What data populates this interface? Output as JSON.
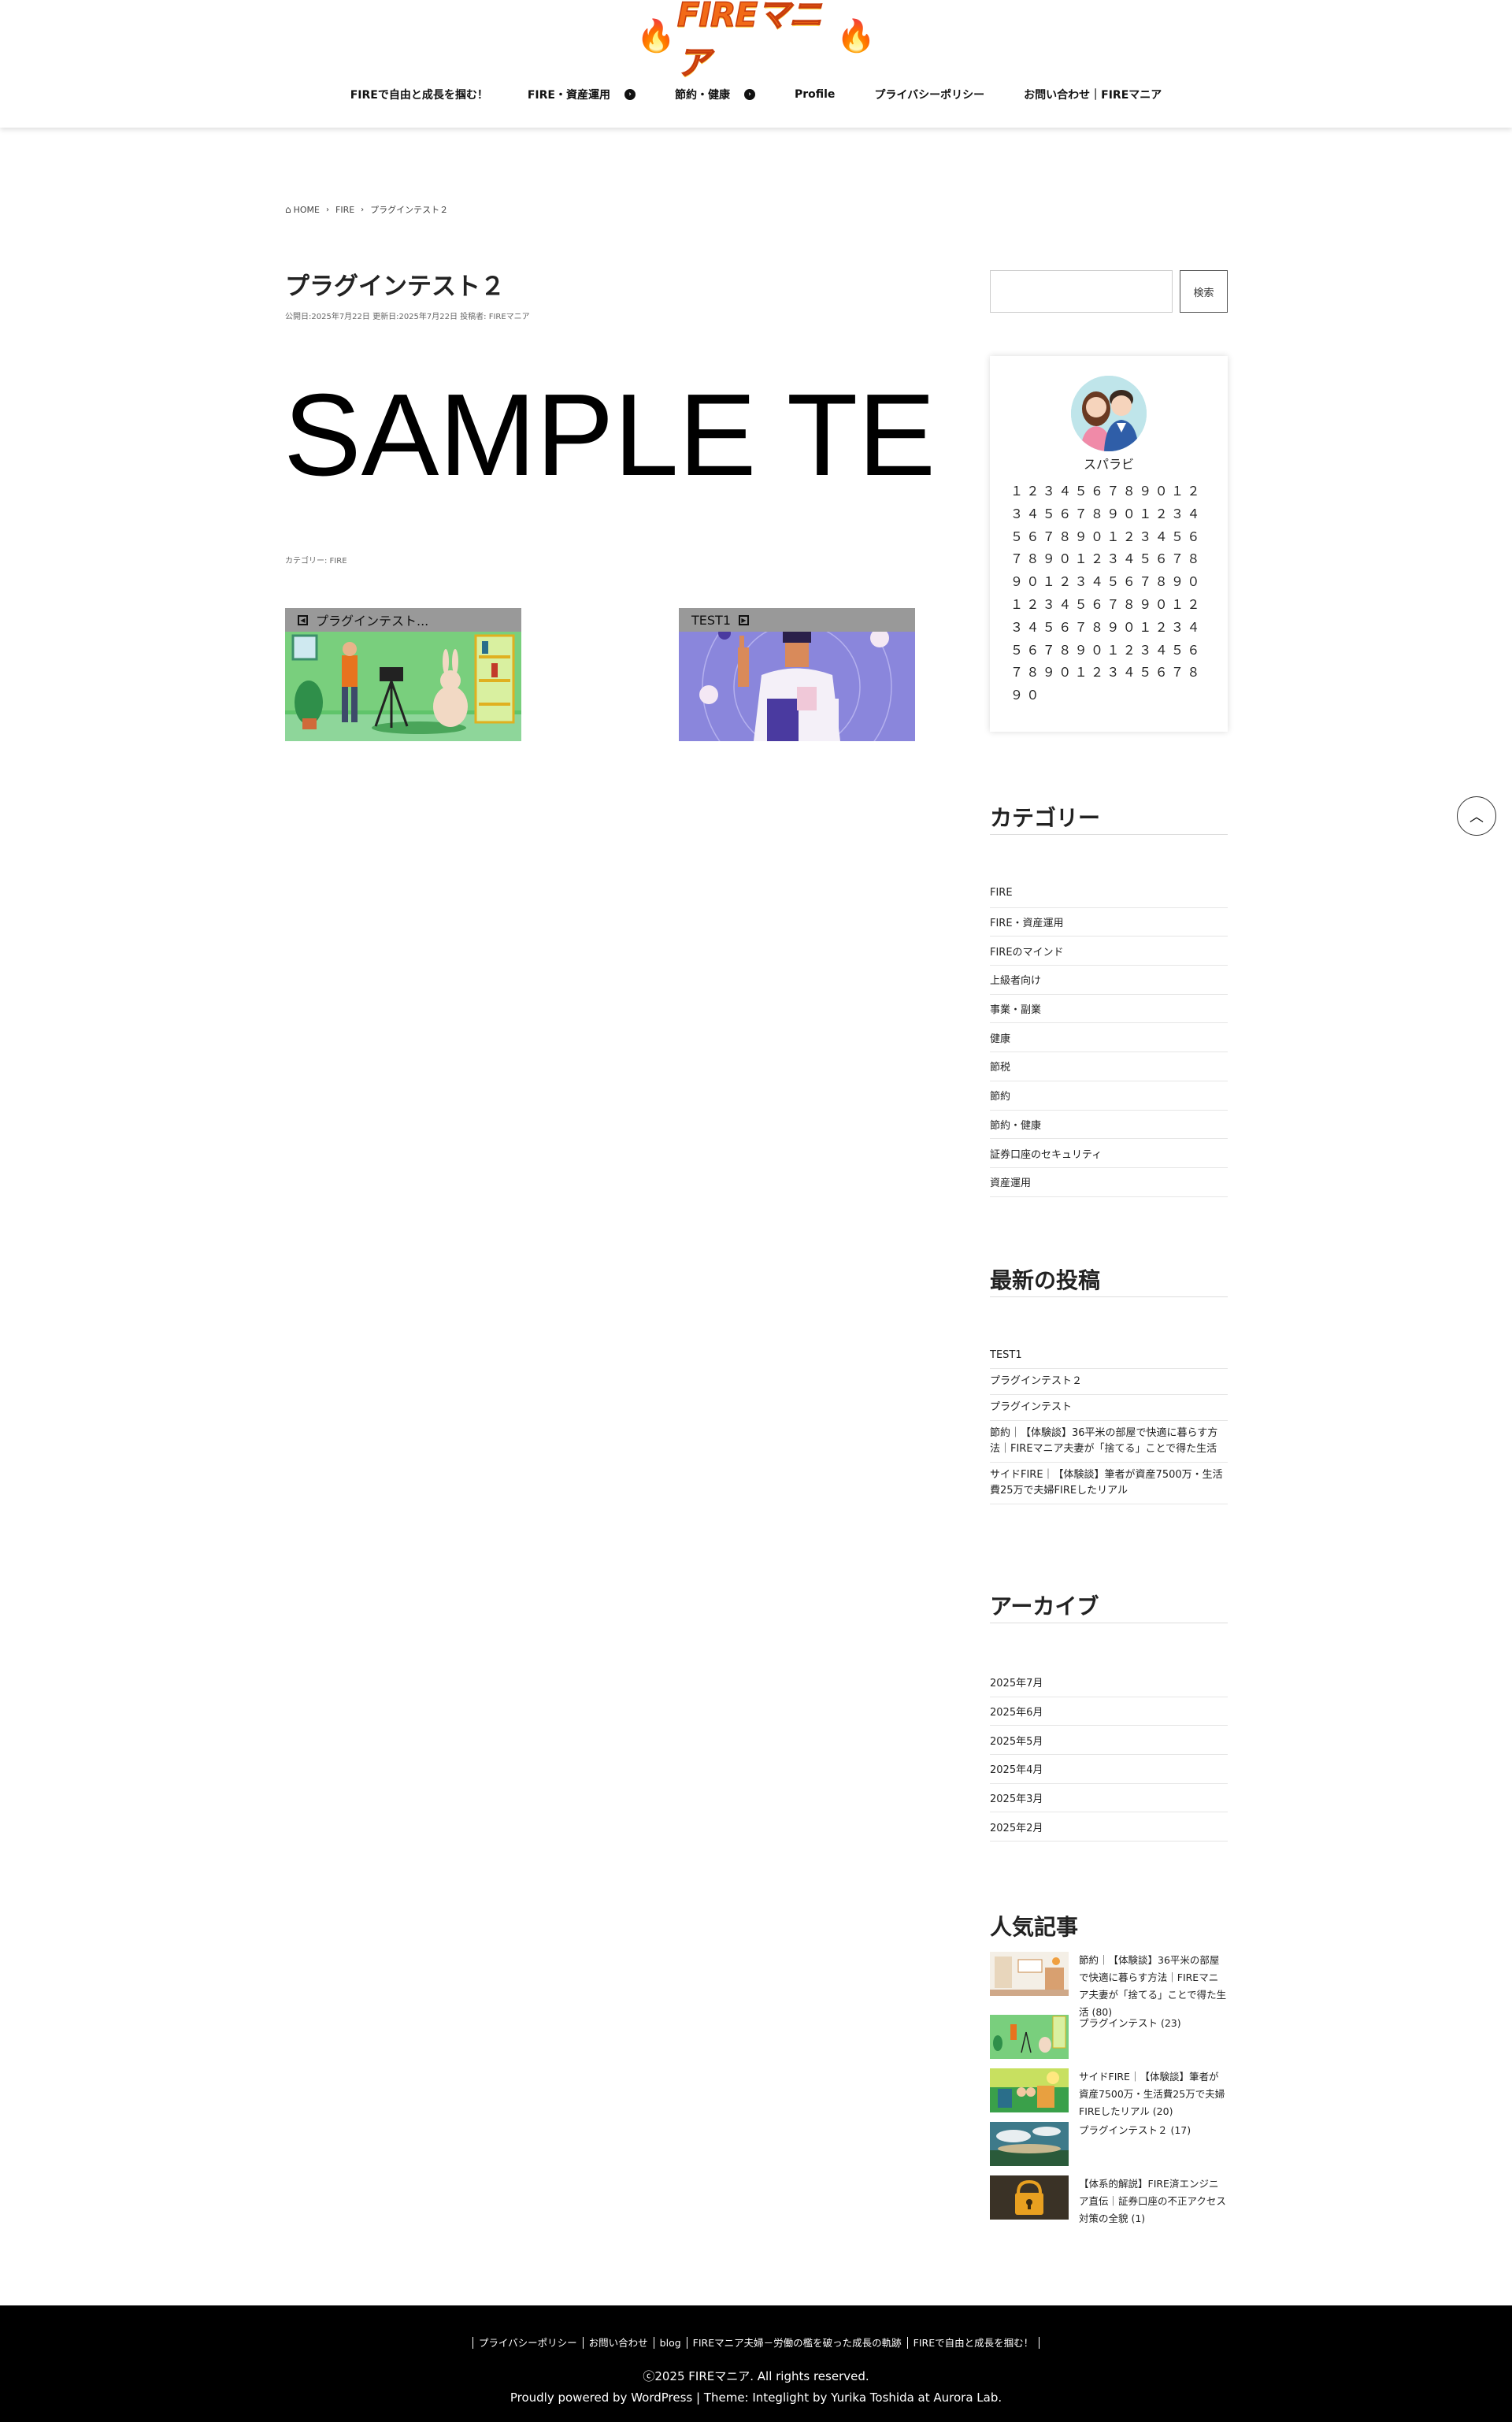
{
  "site": {
    "logo_text": "FIREマニア"
  },
  "nav": [
    {
      "label": "FIREで自由と成長を掴む！",
      "has_submenu": false
    },
    {
      "label": "FIRE・資産運用",
      "has_submenu": true
    },
    {
      "label": "節約・健康",
      "has_submenu": true
    },
    {
      "label": "Profile",
      "has_submenu": false
    },
    {
      "label": "プライバシーポリシー",
      "has_submenu": false
    },
    {
      "label": "お問い合わせ｜FIREマニア",
      "has_submenu": false
    }
  ],
  "breadcrumb": {
    "home": "HOME",
    "category": "FIRE",
    "current": "プラグインテスト２"
  },
  "post": {
    "title": "プラグインテスト２",
    "meta": "公開日:2025年7月22日 更新日:2025年7月22日 投稿者: FIREマニア",
    "body_text": "SAMPLE TE",
    "category_line": "カテゴリー: FIRE"
  },
  "related": {
    "prev_label": "プラグインテスト...",
    "next_label": "TEST1"
  },
  "sidebar": {
    "search_button": "検索",
    "profile": {
      "name": "スパラビ",
      "description": "１２３４５６７８９０１２３４５６７８９０１２３４５６７８９０１２３４５６７８９０１２３４５６７８９０１２３４５６７８９０１２３４５６７８９０１２３４５６７８９０１２３４５６７８９０１２３４５６７８９０１２３４５６７８９０"
    },
    "categories_title": "カテゴリー",
    "categories": [
      "FIRE",
      "FIRE・資産運用",
      "FIREのマインド",
      "上級者向け",
      "事業・副業",
      "健康",
      "節税",
      "節約",
      "節約・健康",
      "証券口座のセキュリティ",
      "資産運用"
    ],
    "recent_title": "最新の投稿",
    "recent": [
      "TEST1",
      "プラグインテスト２",
      "プラグインテスト",
      "節約｜【体験談】36平米の部屋で快適に暮らす方法｜FIREマニア夫妻が「捨てる」ことで得た生活",
      "サイドFIRE｜【体験談】筆者が資産7500万・生活費25万で夫婦FIREしたリアル"
    ],
    "archive_title": "アーカイブ",
    "archives": [
      "2025年7月",
      "2025年6月",
      "2025年5月",
      "2025年4月",
      "2025年3月",
      "2025年2月"
    ],
    "popular_title": "人気記事",
    "popular": [
      "節約｜【体験談】36平米の部屋で快適に暮らす方法｜FIREマニア夫妻が「捨てる」ことで得た生活 (80)",
      "プラグインテスト (23)",
      "サイドFIRE｜【体験談】筆者が資産7500万・生活費25万で夫婦FIREしたリアル (20)",
      "プラグインテスト２ (17)",
      "【体系的解説】FIRE済エンジニア直伝｜証券口座の不正アクセス対策の全貌 (1)"
    ]
  },
  "footer": {
    "links": [
      "プライバシーポリシー",
      "お問い合わせ",
      "blog",
      "FIREマニア夫婦－労働の檻を破った成長の軌跡",
      "FIREで自由と成長を掴む！"
    ],
    "copyright": "ⓒ2025 FIREマニア. All rights reserved.",
    "powered": "Proudly powered by WordPress | Theme: Integlight by Yurika Toshida at Aurora Lab."
  },
  "colors": {
    "accent": "#f26a17",
    "footer_bg": "#000000",
    "related_bar": "#999999"
  }
}
